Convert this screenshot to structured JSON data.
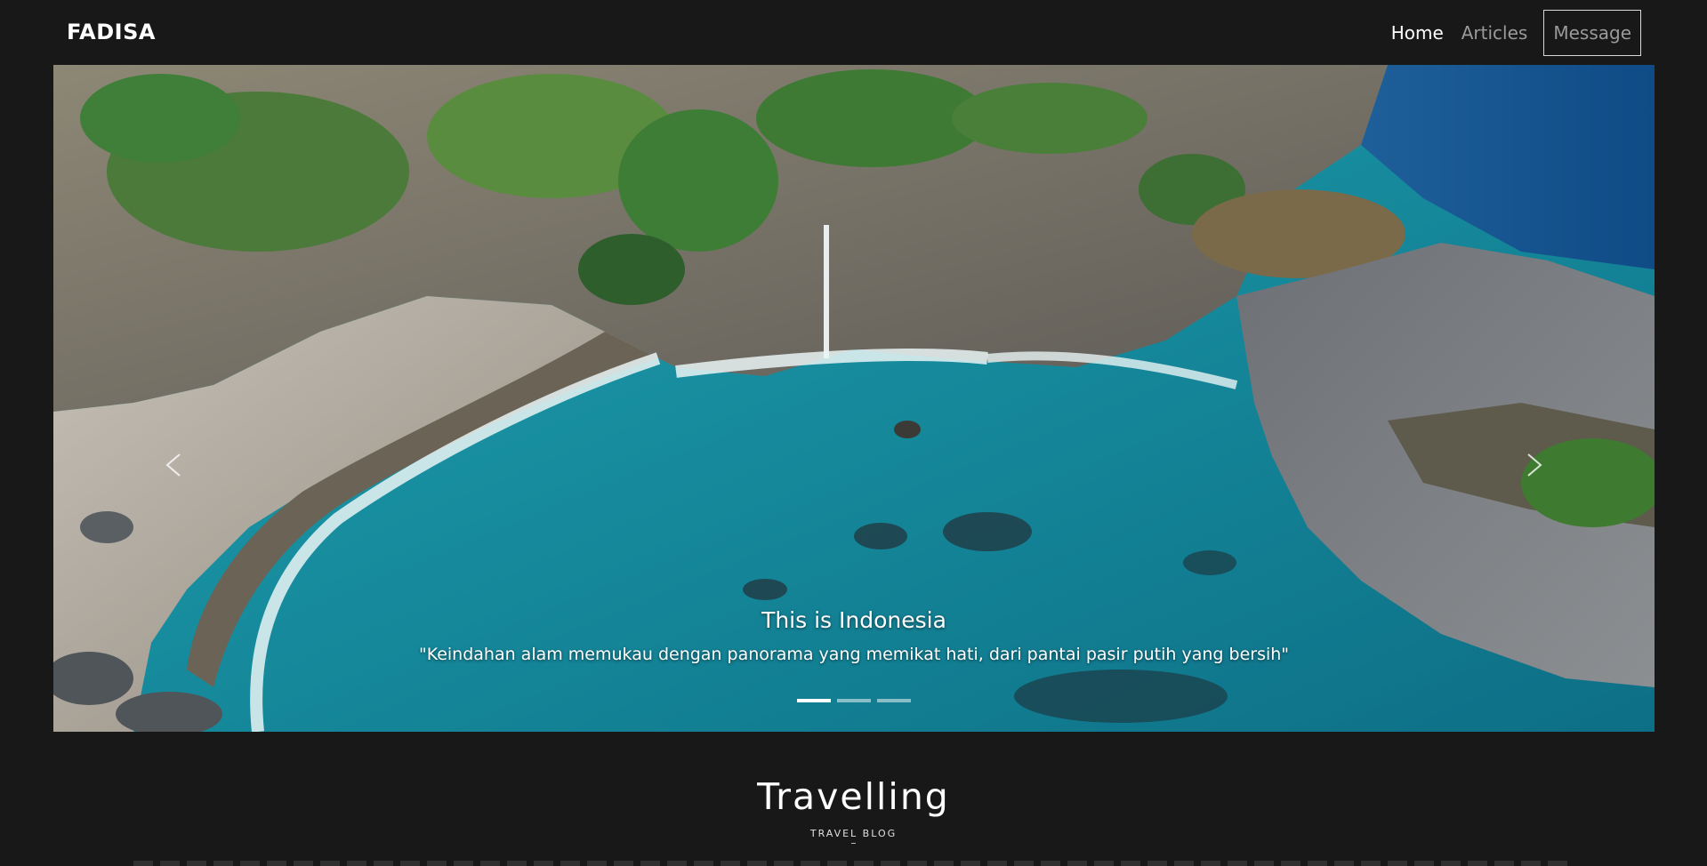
{
  "navbar": {
    "brand": "FADISA",
    "links": [
      {
        "label": "Home",
        "active": true
      },
      {
        "label": "Articles",
        "active": false
      },
      {
        "label": "Message",
        "active": false
      }
    ]
  },
  "hero": {
    "image": "aerial-coastal-cove-photo",
    "caption_title": "This is Indonesia",
    "caption_text": "\"Keindahan alam memukau dengan panorama yang memikat hati, dari pantai pasir putih yang bersih\"",
    "slide_count": 3,
    "active_slide": 1,
    "prev_icon": "chevron-left-icon",
    "next_icon": "chevron-right-icon"
  },
  "section": {
    "title": "Travelling",
    "subtitle": "TRAVEL BLOG"
  },
  "colors": {
    "background": "#181818",
    "text": "#ffffff",
    "nav_inactive": "#9a9a9a",
    "sea": "#1b8a9a"
  }
}
